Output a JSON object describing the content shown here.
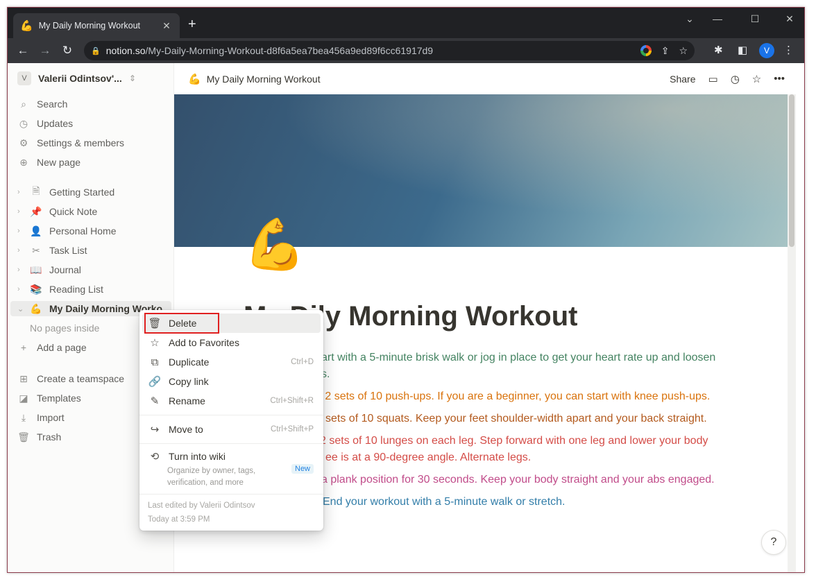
{
  "browser": {
    "tab_title": "My Daily Morning Workout",
    "tab_emoji": "💪",
    "url_host": "notion.so",
    "url_path": "/My-Daily-Morning-Workout-d8f6a5ea7bea456a9ed89f6cc61917d9",
    "profile_initial": "V"
  },
  "sidebar": {
    "workspace_initial": "V",
    "workspace_name": "Valerii Odintsov'...",
    "actions": [
      {
        "label": "Search",
        "icon": "search-icon"
      },
      {
        "label": "Updates",
        "icon": "clock-icon"
      },
      {
        "label": "Settings & members",
        "icon": "gear-icon"
      },
      {
        "label": "New page",
        "icon": "plus-circle-icon"
      }
    ],
    "pages": [
      {
        "label": "Getting Started",
        "icon": "document-icon"
      },
      {
        "label": "Quick Note",
        "icon": "pin-icon"
      },
      {
        "label": "Personal Home",
        "icon": "person-icon"
      },
      {
        "label": "Task List",
        "icon": "scissors-icon"
      },
      {
        "label": "Journal",
        "icon": "book-icon"
      },
      {
        "label": "Reading List",
        "icon": "books-icon"
      },
      {
        "label": "My Daily Morning Worko",
        "icon": "bicep-icon"
      }
    ],
    "no_pages": "No pages inside",
    "add_page": "Add a page",
    "bottom": [
      {
        "label": "Create a teamspace",
        "icon": "teamspace-icon"
      },
      {
        "label": "Templates",
        "icon": "templates-icon"
      },
      {
        "label": "Import",
        "icon": "import-icon"
      },
      {
        "label": "Trash",
        "icon": "trash-icon"
      }
    ]
  },
  "topbar": {
    "breadcrumb": "My Daily Morning Workout",
    "share": "Share"
  },
  "page": {
    "title_visible": "ily Morning Workout",
    "title_partial": "My D",
    "lines": [
      "art with a 5-minute brisk walk or jog in place to get your heart rate up and loosen",
      "s.",
      "o 2 sets of 10 push-ups. If you are a beginner, you can start with knee push-ups.",
      "sets of 10 squats. Keep your feet shoulder-width apart and your back straight.",
      "2 sets of 10 lunges on each leg. Step forward with one leg and lower your body",
      "ee is at a 90-degree angle. Alternate legs.",
      "a plank position for 30 seconds. Keep your body straight and your abs engaged.",
      "End your workout with a 5-minute walk or stretch."
    ],
    "help": "?"
  },
  "menu": {
    "delete": "Delete",
    "favorites": "Add to Favorites",
    "duplicate": "Duplicate",
    "duplicate_sc": "Ctrl+D",
    "copy_link": "Copy link",
    "rename": "Rename",
    "rename_sc": "Ctrl+Shift+R",
    "move_to": "Move to",
    "move_sc": "Ctrl+Shift+P",
    "wiki": "Turn into wiki",
    "wiki_desc": "Organize by owner, tags, verification, and more",
    "wiki_badge": "New",
    "last_edited": "Last edited by Valerii Odintsov",
    "edited_time": "Today at 3:59 PM"
  }
}
